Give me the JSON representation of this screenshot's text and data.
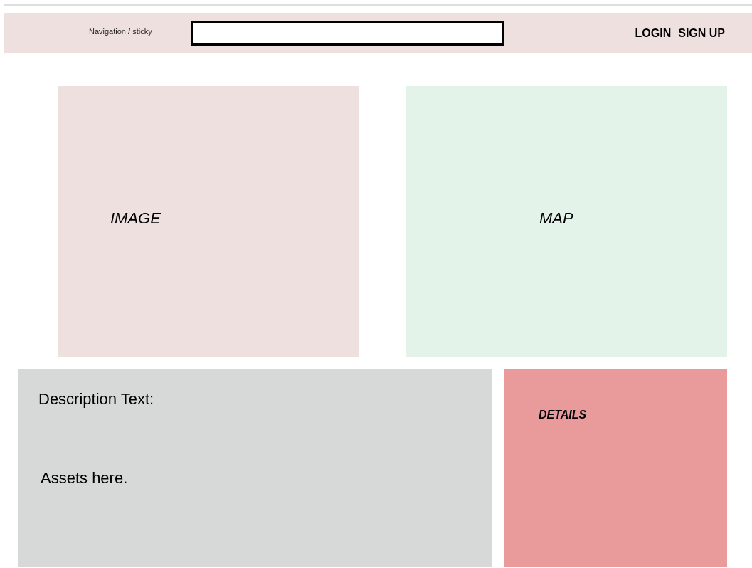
{
  "nav": {
    "label": "Navigation / sticky",
    "search": {
      "kind": "field"
    },
    "links": [
      "LOGIN",
      "SIGN UP"
    ]
  },
  "image_panel": {
    "label": "IMAGE"
  },
  "map_panel": {
    "label": "MAP"
  },
  "description": {
    "title": "Description Text:",
    "body": "Assets here."
  },
  "details": {
    "label": "DETAILS"
  }
}
